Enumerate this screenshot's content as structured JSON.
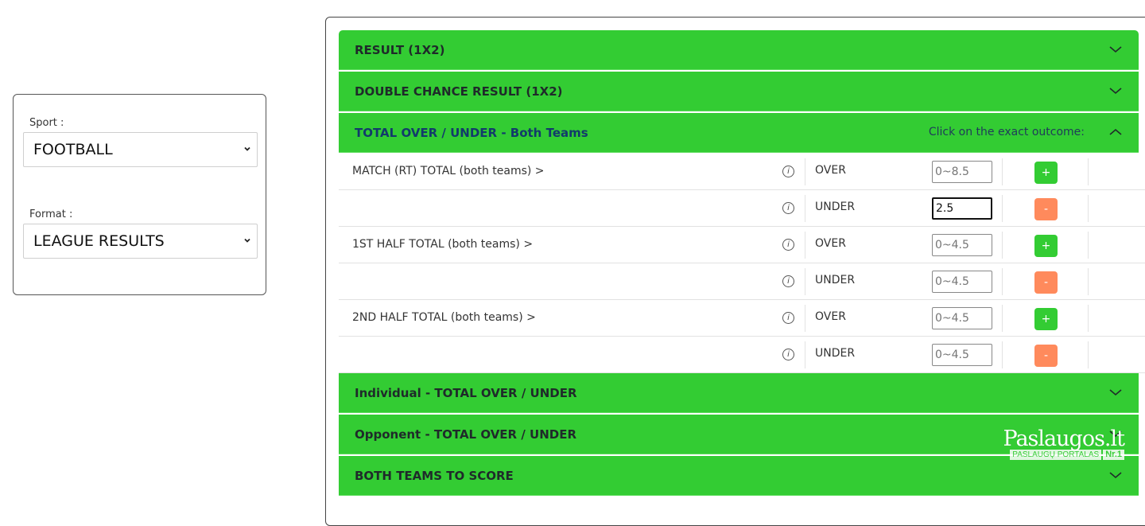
{
  "filters": {
    "sport": {
      "label": "Sport :",
      "value": "FOOTBALL"
    },
    "format": {
      "label": "Format :",
      "value": "LEAGUE RESULTS"
    }
  },
  "accordion": {
    "sections": [
      {
        "title": "RESULT (1X2)"
      },
      {
        "title": "DOUBLE CHANCE RESULT (1X2)"
      },
      {
        "title": "TOTAL OVER / UNDER - Both Teams",
        "hint": "Click on the exact outcome:"
      },
      {
        "title": "Individual - TOTAL OVER / UNDER"
      },
      {
        "title": "Opponent - TOTAL OVER / UNDER"
      },
      {
        "title": "BOTH TEAMS TO SCORE"
      }
    ],
    "rows": [
      {
        "market": "MATCH (RT) TOTAL (both teams) >",
        "outcome": "OVER",
        "placeholder": "0~8.5",
        "value": "",
        "button": "+"
      },
      {
        "market": "",
        "outcome": "UNDER",
        "placeholder": "",
        "value": "2.5",
        "button": "-"
      },
      {
        "market": "1ST HALF TOTAL (both teams) >",
        "outcome": "OVER",
        "placeholder": "0~4.5",
        "value": "",
        "button": "+"
      },
      {
        "market": "",
        "outcome": "UNDER",
        "placeholder": "0~4.5",
        "value": "",
        "button": "-"
      },
      {
        "market": "2ND HALF TOTAL (both teams) >",
        "outcome": "OVER",
        "placeholder": "0~4.5",
        "value": "",
        "button": "+"
      },
      {
        "market": "",
        "outcome": "UNDER",
        "placeholder": "0~4.5",
        "value": "",
        "button": "-"
      }
    ],
    "info_glyph": "i"
  },
  "watermark": {
    "logo": "Paslaugos.lt",
    "portal": "PASLAUGŲ PORTALAS",
    "nr": "Nr.1"
  },
  "colors": {
    "accent_green": "#33cc33",
    "minus_orange": "#ff8a5c",
    "open_title": "#123a6b"
  },
  "icons": {
    "dropdown": "chevron-down-icon",
    "collapse": "chevron-up-icon",
    "info": "info-icon"
  }
}
